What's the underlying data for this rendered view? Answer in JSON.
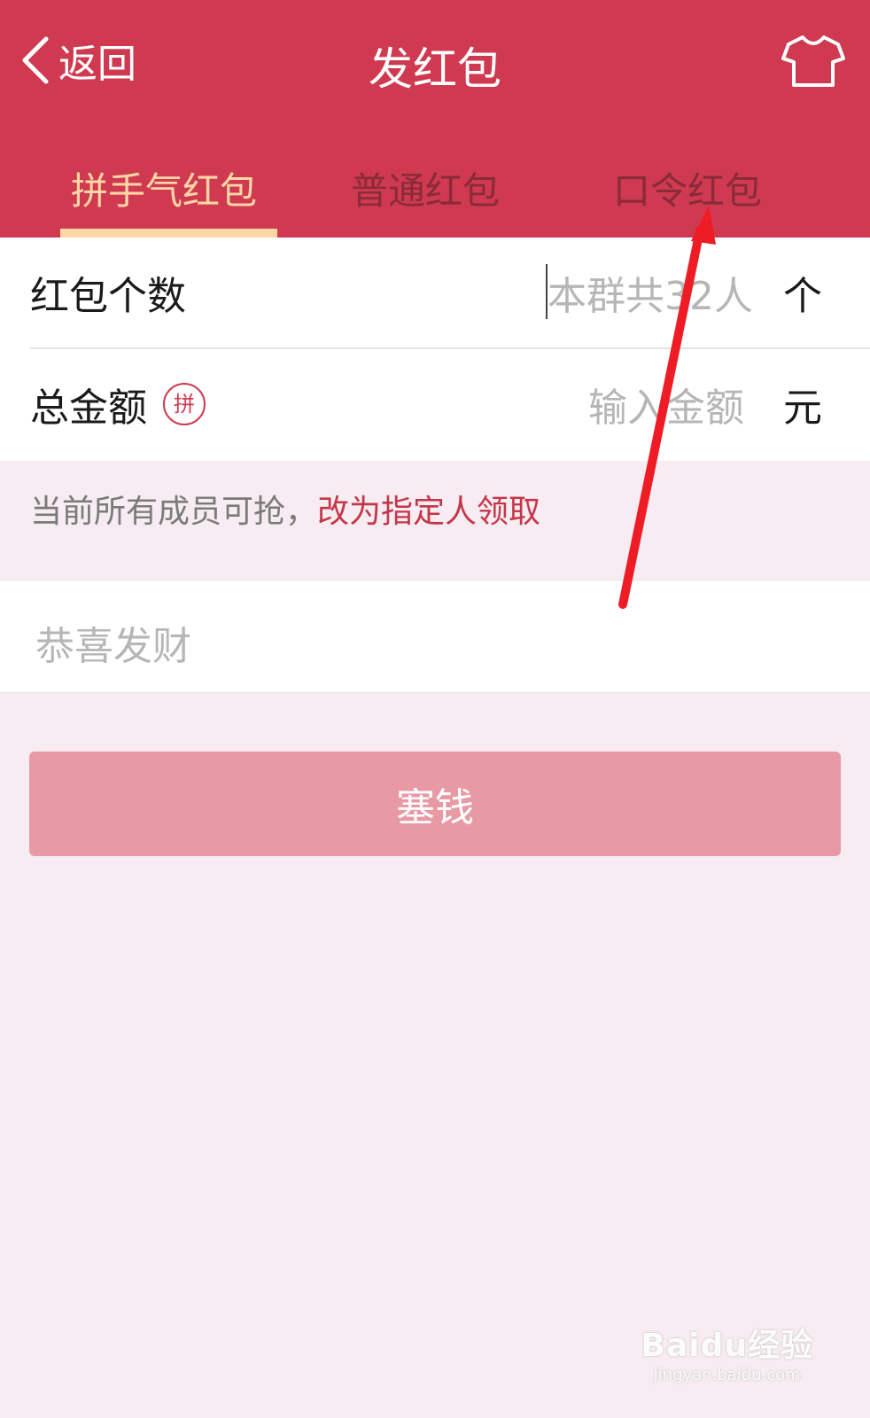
{
  "header": {
    "back_label": "返回",
    "title": "发红包"
  },
  "tabs": [
    {
      "label": "拼手气红包",
      "active": true
    },
    {
      "label": "普通红包",
      "active": false
    },
    {
      "label": "口令红包",
      "active": false
    }
  ],
  "form": {
    "count": {
      "label": "红包个数",
      "placeholder": "本群共32人",
      "unit": "个"
    },
    "amount": {
      "label": "总金额",
      "badge": "拼",
      "placeholder": "输入金额",
      "unit": "元"
    }
  },
  "info": {
    "text": "当前所有成员可抢，",
    "link": "改为指定人领取"
  },
  "greeting": {
    "placeholder": "恭喜发财"
  },
  "submit_label": "塞钱",
  "watermark": {
    "main": "Baidu经验",
    "sub": "jingyan.baidu.com"
  },
  "colors": {
    "header_bg": "#cf3a50",
    "active_tab": "#ffd7a6",
    "button_bg": "#e89aa4",
    "link": "#c5364a",
    "annotation_arrow": "#ee1c25"
  }
}
